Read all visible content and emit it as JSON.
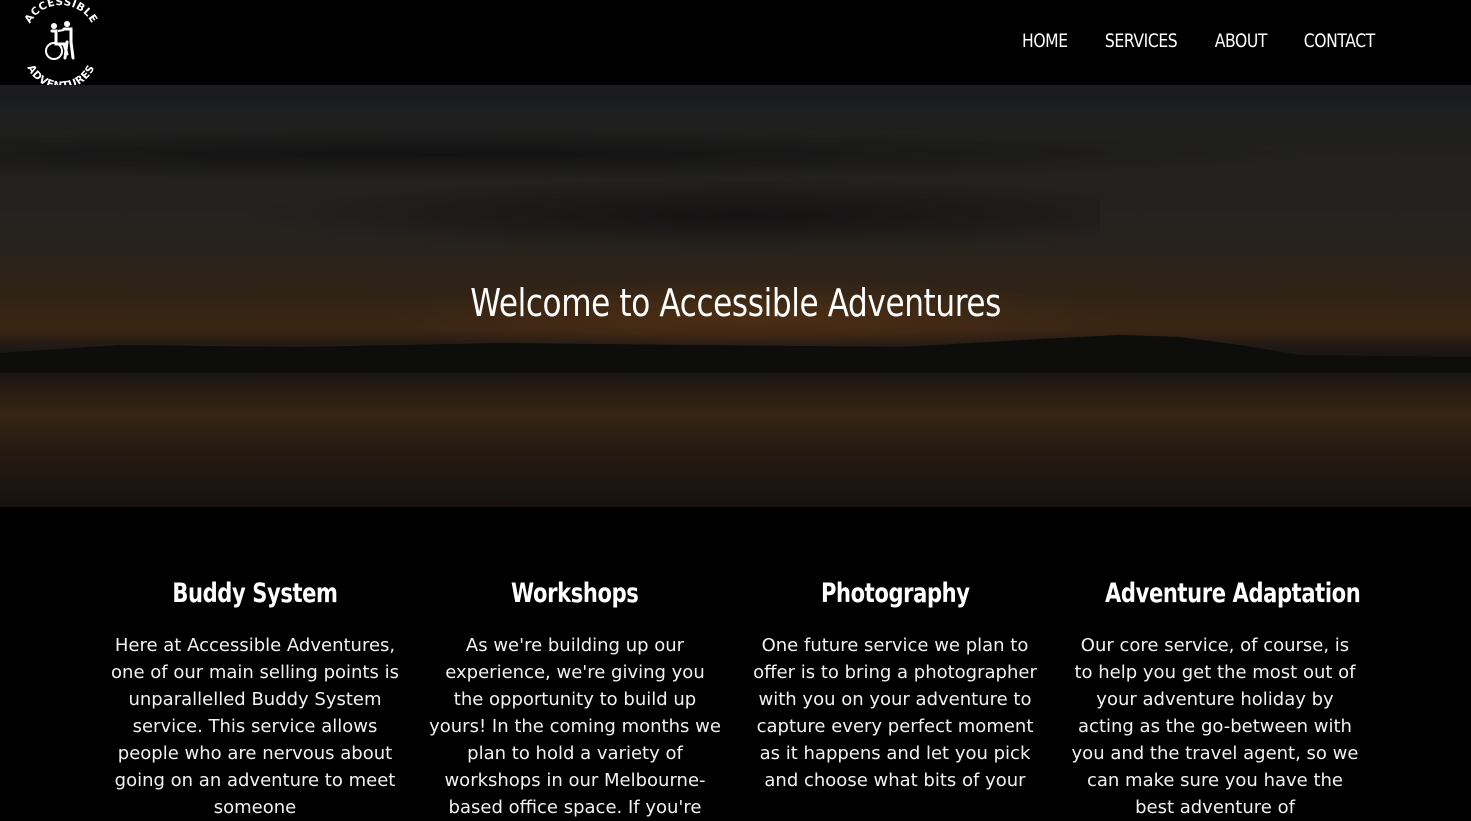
{
  "header": {
    "logo": {
      "text_top": "ACCESSIBLE",
      "text_bottom": "ADVENTURES",
      "icon": "wheelchair-buddy-icon"
    },
    "nav": [
      {
        "label": "HOME"
      },
      {
        "label": "SERVICES"
      },
      {
        "label": "ABOUT"
      },
      {
        "label": "CONTACT"
      }
    ]
  },
  "hero": {
    "title": "Welcome to Accessible Adventures"
  },
  "services": [
    {
      "title": "Buddy System",
      "text": "Here at Accessible Adventures, one of our main selling points is unparallelled Buddy System service. This service allows people who are nervous about going on an adventure to meet someone"
    },
    {
      "title": "Workshops",
      "text": "As we're building up our experience, we're giving you the opportunity to build up yours! In the coming months we plan to hold a variety of workshops in our Melbourne-based office space. If you're"
    },
    {
      "title": "Photography",
      "text": "One future service we plan to offer is to bring a photographer with you on your adventure to capture every perfect moment as it happens and let you pick and choose what bits of your"
    },
    {
      "title": "Adventure Adaptation",
      "text": "Our core service, of course, is to help you get the most out of your adventure holiday by acting as the go-between with you and the travel agent, so we can make sure you have the best adventure of"
    }
  ]
}
